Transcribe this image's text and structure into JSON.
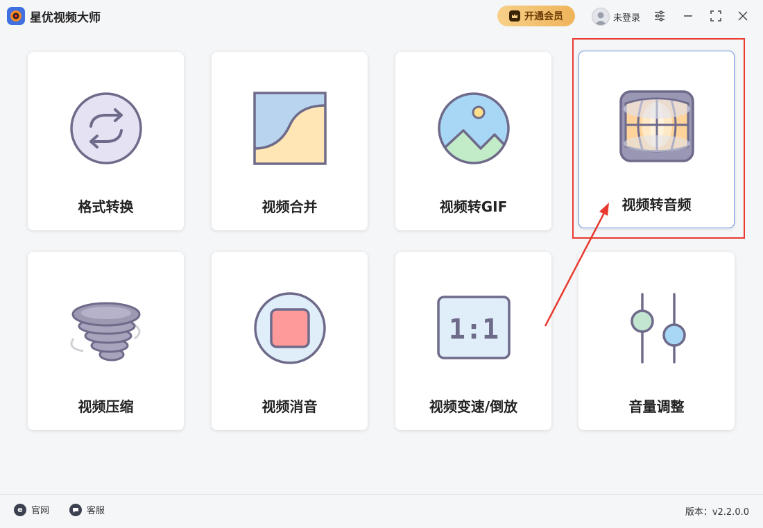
{
  "app": {
    "title": "星优视频大师"
  },
  "header": {
    "vip_label": "开通会员",
    "user_label": "未登录"
  },
  "tools": [
    {
      "label": "格式转换",
      "icon": "format-convert-icon"
    },
    {
      "label": "视频合并",
      "icon": "video-merge-icon"
    },
    {
      "label": "视频转GIF",
      "icon": "video-to-gif-icon"
    },
    {
      "label": "视频转音频",
      "icon": "video-to-audio-icon"
    },
    {
      "label": "视频压缩",
      "icon": "video-compress-icon"
    },
    {
      "label": "视频消音",
      "icon": "video-mute-icon"
    },
    {
      "label": "视频变速/倒放",
      "icon": "video-speed-icon"
    },
    {
      "label": "音量调整",
      "icon": "volume-adjust-icon"
    }
  ],
  "ratio_glyph": "1:1",
  "footer": {
    "website_label": "官网",
    "service_label": "客服",
    "version": "版本：v2.2.0.0"
  },
  "colors": {
    "highlight": "#e83a2e",
    "accent": "#3f6fe0",
    "icon_stroke": "#6e6a8a"
  }
}
